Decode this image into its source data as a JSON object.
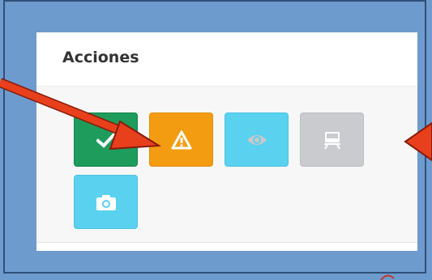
{
  "panel": {
    "title": "Acciones"
  },
  "buttons": [
    {
      "name": "approve",
      "icon": "check-icon",
      "color": "#1e9c5c"
    },
    {
      "name": "warning",
      "icon": "warning-icon",
      "color": "#f39c12"
    },
    {
      "name": "view",
      "icon": "eye-icon",
      "color": "#5ad1ef"
    },
    {
      "name": "train",
      "icon": "train-icon",
      "color": "#c9cbcf"
    },
    {
      "name": "photo",
      "icon": "camera-icon",
      "color": "#5ad1ef"
    }
  ],
  "annotation_color": "#e8401c"
}
